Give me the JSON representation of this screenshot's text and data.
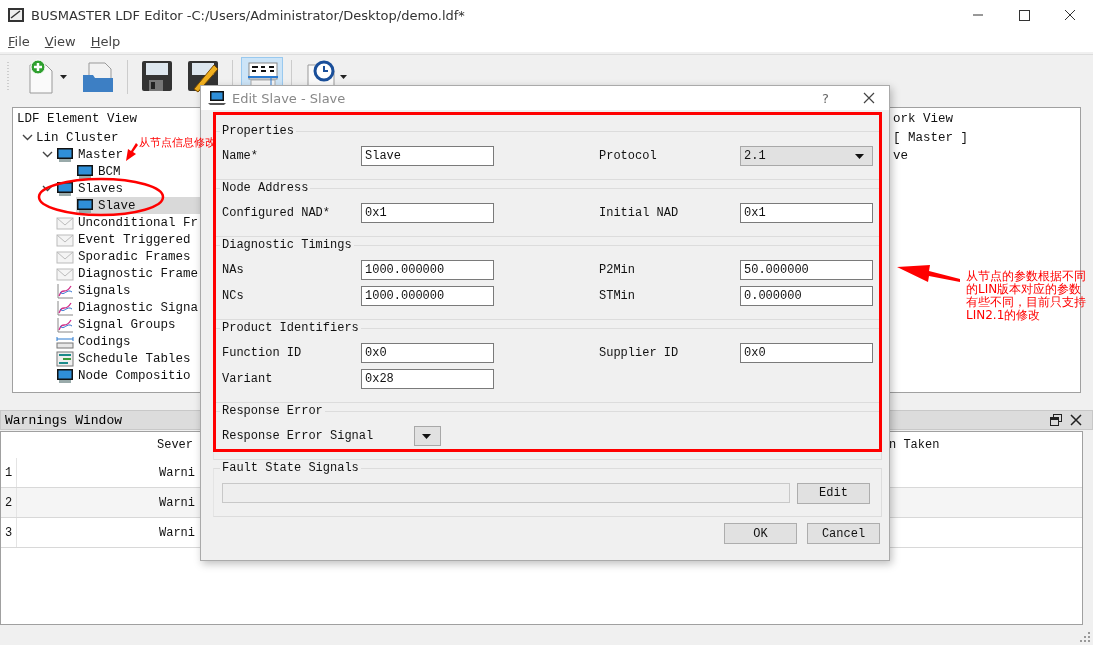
{
  "window": {
    "title": "BUSMASTER LDF Editor -C:/Users/Administrator/Desktop/demo.ldf*"
  },
  "menu": [
    "File",
    "View",
    "Help"
  ],
  "toolbar": [
    {
      "kind": "new",
      "dropdown": true,
      "selected": false
    },
    {
      "kind": "open",
      "dropdown": false,
      "selected": false
    },
    {
      "kind": "save",
      "dropdown": false,
      "selected": false
    },
    {
      "kind": "edit",
      "dropdown": false,
      "selected": false
    },
    {
      "kind": "import",
      "dropdown": false,
      "selected": true
    },
    {
      "kind": "clock",
      "dropdown": true,
      "selected": false
    }
  ],
  "element_view": {
    "title": "LDF Element View",
    "tree": [
      {
        "label": "Lin Cluster",
        "expanded": true,
        "selected": false,
        "children": [
          {
            "label": "Master",
            "kind": "node",
            "expanded": true,
            "selected": false,
            "children": [
              {
                "label": "BCM",
                "kind": "node",
                "selected": false
              }
            ]
          },
          {
            "label": "Slaves",
            "kind": "node",
            "expanded": true,
            "selected": false,
            "children": [
              {
                "label": "Slave",
                "kind": "node",
                "selected": true
              }
            ]
          },
          {
            "label": "Unconditional Fr",
            "kind": "frame",
            "selected": false
          },
          {
            "label": "Event Triggered",
            "kind": "frame",
            "selected": false
          },
          {
            "label": "Sporadic Frames",
            "kind": "frame",
            "selected": false
          },
          {
            "label": "Diagnostic Frame",
            "kind": "frame",
            "selected": false
          },
          {
            "label": "Signals",
            "kind": "signal",
            "selected": false
          },
          {
            "label": "Diagnostic Signa",
            "kind": "signal",
            "selected": false
          },
          {
            "label": "Signal Groups",
            "kind": "signal",
            "selected": false
          },
          {
            "label": "Codings",
            "kind": "coding",
            "selected": false
          },
          {
            "label": "Schedule Tables",
            "kind": "schedule",
            "selected": false
          },
          {
            "label": "Node Compositio",
            "kind": "node",
            "selected": false
          }
        ]
      }
    ]
  },
  "network_view": {
    "title": "ork View",
    "lines": [
      "[ Master ]",
      "ve"
    ]
  },
  "warnings": {
    "title": "Warnings Window",
    "columns": [
      "Sever",
      "n Taken"
    ],
    "rows": [
      {
        "number": "1",
        "cells": [
          "Warni"
        ]
      },
      {
        "number": "2",
        "cells": [
          "Warni"
        ]
      },
      {
        "number": "3",
        "cells": [
          "Warni"
        ]
      }
    ]
  },
  "dialog": {
    "title": "Edit Slave - Slave",
    "help": "?",
    "sections": [
      {
        "title": "Properties",
        "rows": [
          [
            {
              "label": "Name*",
              "kind": "text",
              "value": "Slave"
            },
            {
              "label": "Protocol",
              "kind": "combo",
              "value": "2.1"
            }
          ]
        ]
      },
      {
        "title": "Node Address",
        "rows": [
          [
            {
              "label": "Configured NAD*",
              "kind": "text",
              "value": "0x1"
            },
            {
              "label": "Initial NAD",
              "kind": "text",
              "value": "0x1"
            }
          ]
        ]
      },
      {
        "title": "Diagnostic Timings",
        "rows": [
          [
            {
              "label": "NAs",
              "kind": "text",
              "value": "1000.000000"
            },
            {
              "label": "P2Min",
              "kind": "text",
              "value": "50.000000"
            }
          ],
          [
            {
              "label": "NCs",
              "kind": "text",
              "value": "1000.000000"
            },
            {
              "label": "STMin",
              "kind": "text",
              "value": "0.000000"
            }
          ]
        ]
      },
      {
        "title": "Product Identifiers",
        "rows": [
          [
            {
              "label": "Function ID",
              "kind": "text",
              "value": "0x0"
            },
            {
              "label": "Supplier ID",
              "kind": "text",
              "value": "0x0"
            }
          ],
          [
            {
              "label": "Variant",
              "kind": "text",
              "value": "0x28"
            }
          ]
        ]
      },
      {
        "title": "Response Error",
        "rows": [
          [
            {
              "label": "Response Error Signal",
              "kind": "combo"
            }
          ]
        ]
      }
    ],
    "fault_state": {
      "title": "Fault State Signals",
      "button": "Edit"
    },
    "buttons": [
      "OK",
      "Cancel"
    ]
  },
  "callouts": [
    {
      "text": "从节点信息修改"
    },
    {
      "text": "从节点的参数根据不同的LIN版本对应的参数有些不同，目前只支持LIN2.1的修改"
    }
  ]
}
